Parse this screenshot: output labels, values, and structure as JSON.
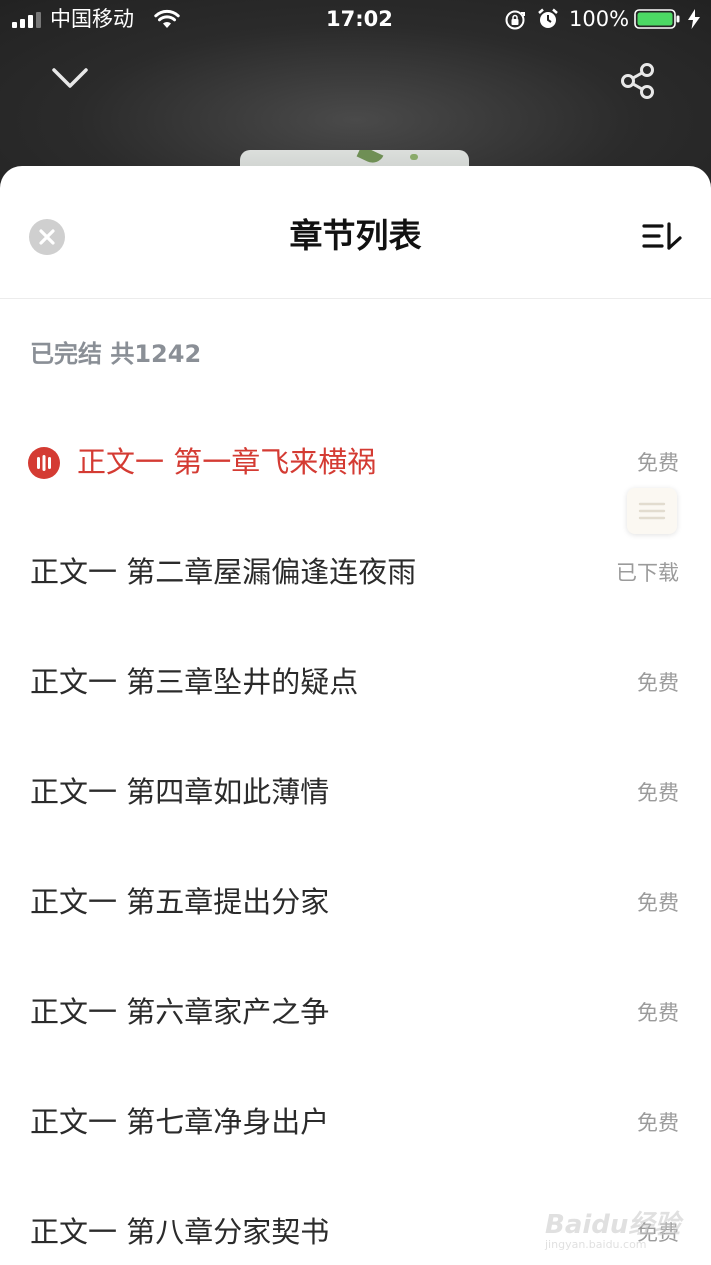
{
  "status_bar": {
    "carrier": "中国移动",
    "time": "17:02",
    "battery_percent": "100%",
    "battery_level": 1.0,
    "icons": [
      "signal-icon",
      "wifi-icon",
      "rotation-lock-icon",
      "alarm-icon",
      "battery-icon",
      "charging-bolt-icon"
    ]
  },
  "header": {
    "collapse_icon": "chevron-down-icon",
    "share_icon": "share-icon"
  },
  "sheet": {
    "title": "章节列表",
    "close_icon": "close-icon",
    "sort_icon": "sort-icon",
    "summary_status": "已完结",
    "summary_prefix": "共",
    "summary_count": "1242"
  },
  "chapters": [
    {
      "title": "正文一 第一章飞来横祸",
      "status": "免费",
      "current": true
    },
    {
      "title": "正文一 第二章屋漏偏逢连夜雨",
      "status": "已下载",
      "current": false
    },
    {
      "title": "正文一 第三章坠井的疑点",
      "status": "免费",
      "current": false
    },
    {
      "title": "正文一 第四章如此薄情",
      "status": "免费",
      "current": false
    },
    {
      "title": "正文一 第五章提出分家",
      "status": "免费",
      "current": false
    },
    {
      "title": "正文一 第六章家产之争",
      "status": "免费",
      "current": false
    },
    {
      "title": "正文一 第七章净身出户",
      "status": "免费",
      "current": false
    },
    {
      "title": "正文一 第八章分家契书",
      "status": "免费",
      "current": false
    }
  ],
  "watermark": {
    "text": "Baidu经验",
    "sub": "jingyan.baidu.com"
  },
  "colors": {
    "accent_red": "#d43b33",
    "text_primary": "#2b2b2b",
    "text_muted": "#9b9b9b",
    "battery_green": "#4cd964"
  }
}
